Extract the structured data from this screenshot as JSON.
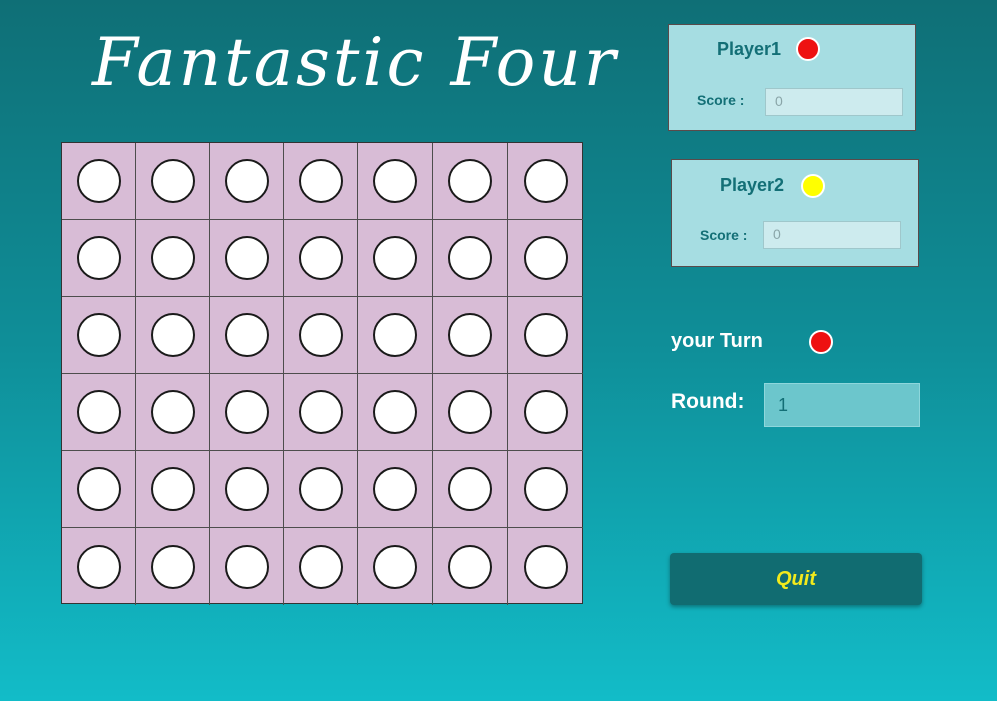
{
  "title": "Fantastic Four",
  "board": {
    "columns": 7,
    "rows": 6,
    "cell_background": "#d8bcd6",
    "empty_slot_color": "#ffffff"
  },
  "players": [
    {
      "name": "Player1",
      "disc_color": "#ee1111",
      "score_label": "Score :",
      "score_value": "0"
    },
    {
      "name": "Player2",
      "disc_color": "#ffff00",
      "score_label": "Score :",
      "score_value": "0"
    }
  ],
  "turn": {
    "label": "your Turn",
    "disc_color": "#ee1111"
  },
  "round": {
    "label": "Round:",
    "value": "1"
  },
  "quit_button": {
    "label": "Quit"
  },
  "colors": {
    "accent_text": "#136f76",
    "quit_text": "#f2ea1c",
    "panel_background": "#a6dde2"
  }
}
